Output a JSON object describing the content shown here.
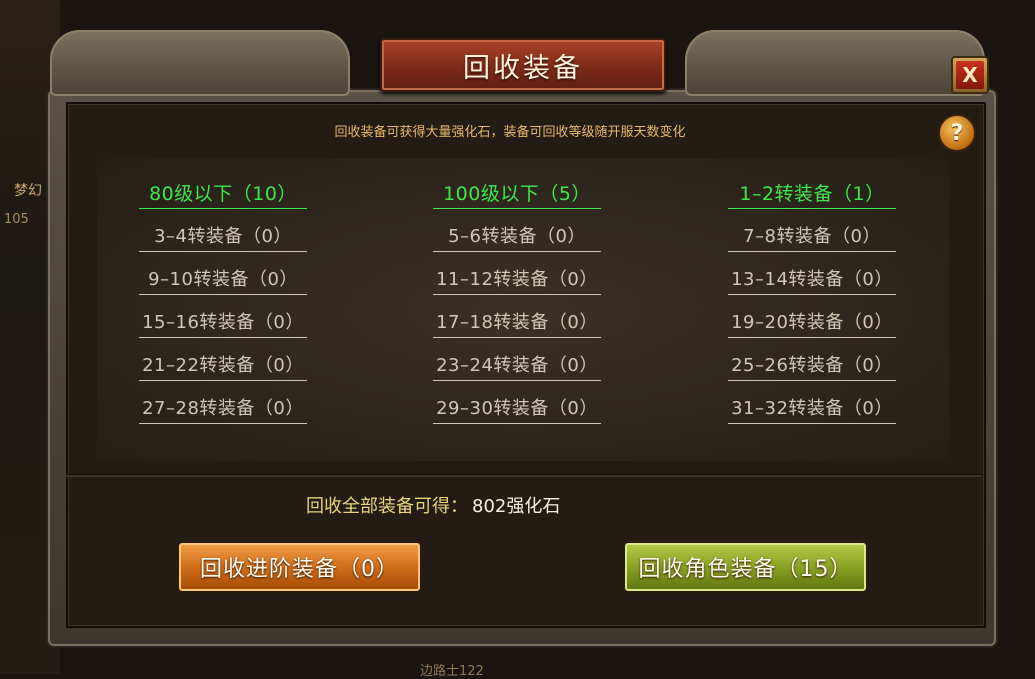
{
  "window": {
    "title": "回收装备",
    "close_label": "X",
    "help_label": "?"
  },
  "background": {
    "left_text": "梦幻",
    "left_num": "105",
    "bottom_text": "边路士122"
  },
  "hint": "回收装备可获得大量强化石，装备可回收等级随开服天数变化",
  "categories": [
    {
      "label": "80级以下（10）",
      "active": true
    },
    {
      "label": "100级以下（5）",
      "active": true
    },
    {
      "label": "1–2转装备（1）",
      "active": true
    },
    {
      "label": "3–4转装备（0）",
      "active": false
    },
    {
      "label": "5–6转装备（0）",
      "active": false
    },
    {
      "label": "7–8转装备（0）",
      "active": false
    },
    {
      "label": "9–10转装备（0）",
      "active": false
    },
    {
      "label": "11–12转装备（0）",
      "active": false
    },
    {
      "label": "13–14转装备（0）",
      "active": false
    },
    {
      "label": "15–16转装备（0）",
      "active": false
    },
    {
      "label": "17–18转装备（0）",
      "active": false
    },
    {
      "label": "19–20转装备（0）",
      "active": false
    },
    {
      "label": "21–22转装备（0）",
      "active": false
    },
    {
      "label": "23–24转装备（0）",
      "active": false
    },
    {
      "label": "25–26转装备（0）",
      "active": false
    },
    {
      "label": "27–28转装备（0）",
      "active": false
    },
    {
      "label": "29–30转装备（0）",
      "active": false
    },
    {
      "label": "31–32转装备（0）",
      "active": false
    }
  ],
  "total": {
    "label": "回收全部装备可得：",
    "value": "802强化石"
  },
  "buttons": {
    "advanced": "回收进阶装备（0）",
    "role": "回收角色装备（15）"
  },
  "colors": {
    "active": "#3fe64a",
    "inactive": "#cfc7b6",
    "hint": "#e7b86a",
    "total_label": "#e8d37a"
  }
}
